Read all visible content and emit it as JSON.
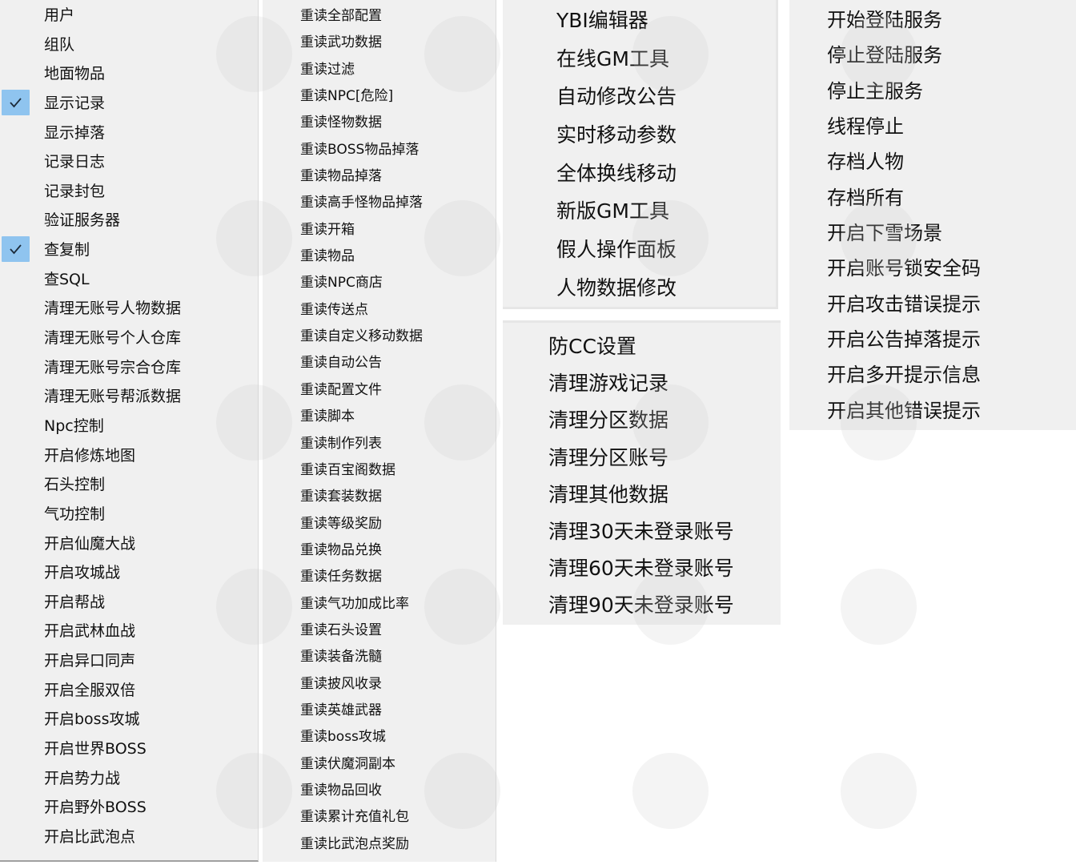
{
  "menus": {
    "general": {
      "items": [
        {
          "label": "用户",
          "checked": false
        },
        {
          "label": "组队",
          "checked": false
        },
        {
          "label": "地面物品",
          "checked": false
        },
        {
          "label": "显示记录",
          "checked": true
        },
        {
          "label": "显示掉落",
          "checked": false
        },
        {
          "label": "记录日志",
          "checked": false
        },
        {
          "label": "记录封包",
          "checked": false
        },
        {
          "label": "验证服务器",
          "checked": false
        },
        {
          "label": "查复制",
          "checked": true
        },
        {
          "label": "查SQL",
          "checked": false
        },
        {
          "label": "清理无账号人物数据",
          "checked": false
        },
        {
          "label": "清理无账号个人仓库",
          "checked": false
        },
        {
          "label": "清理无账号宗合仓库",
          "checked": false
        },
        {
          "label": "清理无账号帮派数据",
          "checked": false
        },
        {
          "label": "Npc控制",
          "checked": false
        },
        {
          "label": "开启修炼地图",
          "checked": false
        },
        {
          "label": "石头控制",
          "checked": false
        },
        {
          "label": "气功控制",
          "checked": false
        },
        {
          "label": "开启仙魔大战",
          "checked": false
        },
        {
          "label": "开启攻城战",
          "checked": false
        },
        {
          "label": "开启帮战",
          "checked": false
        },
        {
          "label": "开启武林血战",
          "checked": false
        },
        {
          "label": "开启异口同声",
          "checked": false
        },
        {
          "label": "开启全服双倍",
          "checked": false
        },
        {
          "label": "开启boss攻城",
          "checked": false
        },
        {
          "label": "开启世界BOSS",
          "checked": false
        },
        {
          "label": "开启势力战",
          "checked": false
        },
        {
          "label": "开启野外BOSS",
          "checked": false
        },
        {
          "label": "开启比武泡点",
          "checked": false
        }
      ]
    },
    "reload": {
      "items": [
        "重读全部配置",
        "重读武功数据",
        "重读过滤",
        "重读NPC[危险]",
        "重读怪物数据",
        "重读BOSS物品掉落",
        "重读物品掉落",
        "重读高手怪物品掉落",
        "重读开箱",
        "重读物品",
        "重读NPC商店",
        "重读传送点",
        "重读自定义移动数据",
        "重读自动公告",
        "重读配置文件",
        "重读脚本",
        "重读制作列表",
        "重读百宝阁数据",
        "重读套装数据",
        "重读等级奖励",
        "重读物品兑换",
        "重读任务数据",
        "重读气功加成比率",
        "重读石头设置",
        "重读装备洗髓",
        "重读披风收录",
        "重读英雄武器",
        "重读boss攻城",
        "重读伏魔洞副本",
        "重读物品回收",
        "重读累计充值礼包",
        "重读比武泡点奖励"
      ]
    },
    "tools": {
      "items": [
        "YBI编辑器",
        "在线GM工具",
        "自动修改公告",
        "实时移动参数",
        "全体换线移动",
        "新版GM工具",
        "假人操作面板",
        "人物数据修改"
      ]
    },
    "cleanup": {
      "items": [
        "防CC设置",
        "清理游戏记录",
        "清理分区数据",
        "清理分区账号",
        "清理其他数据",
        "清理30天未登录账号",
        "清理60天未登录账号",
        "清理90天未登录账号"
      ]
    },
    "server": {
      "items": [
        "开始登陆服务",
        "停止登陆服务",
        "停止主服务",
        "线程停止",
        "存档人物",
        "存档所有",
        "开启下雪场景",
        "开启账号锁安全码",
        "开启攻击错误提示",
        "开启公告掉落提示",
        "开启多开提示信息",
        "开启其他错误提示"
      ]
    }
  },
  "icons": {
    "check": "checkmark-icon"
  },
  "colors": {
    "menu_bg": "#f0f0f0",
    "check_bg": "#8fc4ef"
  }
}
